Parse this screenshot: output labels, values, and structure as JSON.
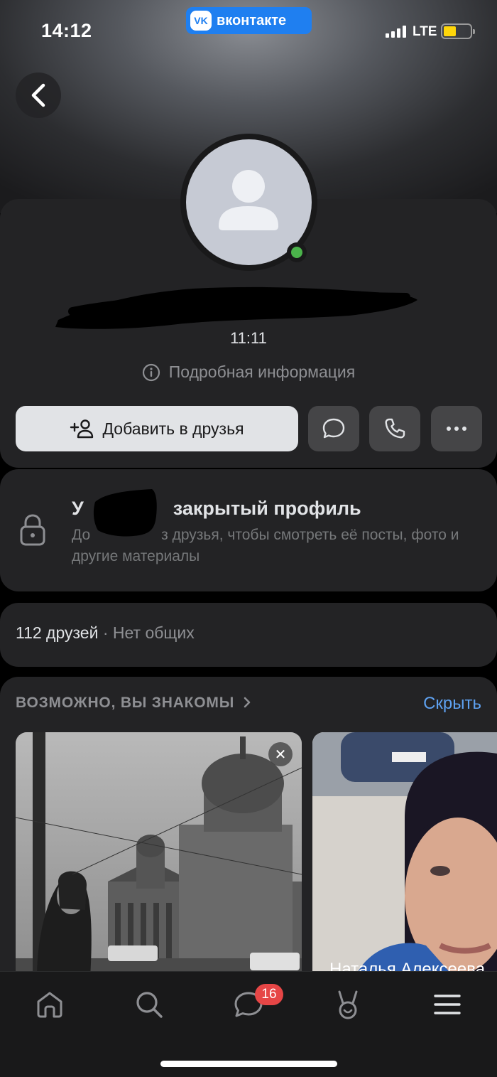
{
  "status_bar": {
    "time": "14:12",
    "network": "LTE",
    "app_badge": "вконтакте",
    "app_badge_logo": "VK"
  },
  "profile": {
    "last_seen": "11:11",
    "details_label": "Подробная информация",
    "add_friend_label": "Добавить в друзья",
    "online": true
  },
  "closed_profile": {
    "title_prefix": "У",
    "title_suffix": "закрытый профиль",
    "subtitle_prefix": "До",
    "subtitle": "з друзья, чтобы смотреть её посты, фото и другие материалы"
  },
  "friends": {
    "count_label": "112 друзей",
    "separator": " · ",
    "mutual_label": "Нет общих"
  },
  "suggestions": {
    "title": "ВОЗМОЖНО, ВЫ ЗНАКОМЫ",
    "hide_label": "Скрыть",
    "cards": [
      {
        "name": ""
      },
      {
        "name": "Наталья Алексеева"
      }
    ]
  },
  "tabbar": {
    "items": [
      "home-icon",
      "search-icon",
      "messages-icon",
      "clips-icon",
      "menu-icon"
    ],
    "messages_badge": "16"
  },
  "colors": {
    "accent": "#5ea1f0",
    "vk_blue": "#1f7ff0",
    "online": "#4bb34b",
    "badge": "#e64646"
  }
}
